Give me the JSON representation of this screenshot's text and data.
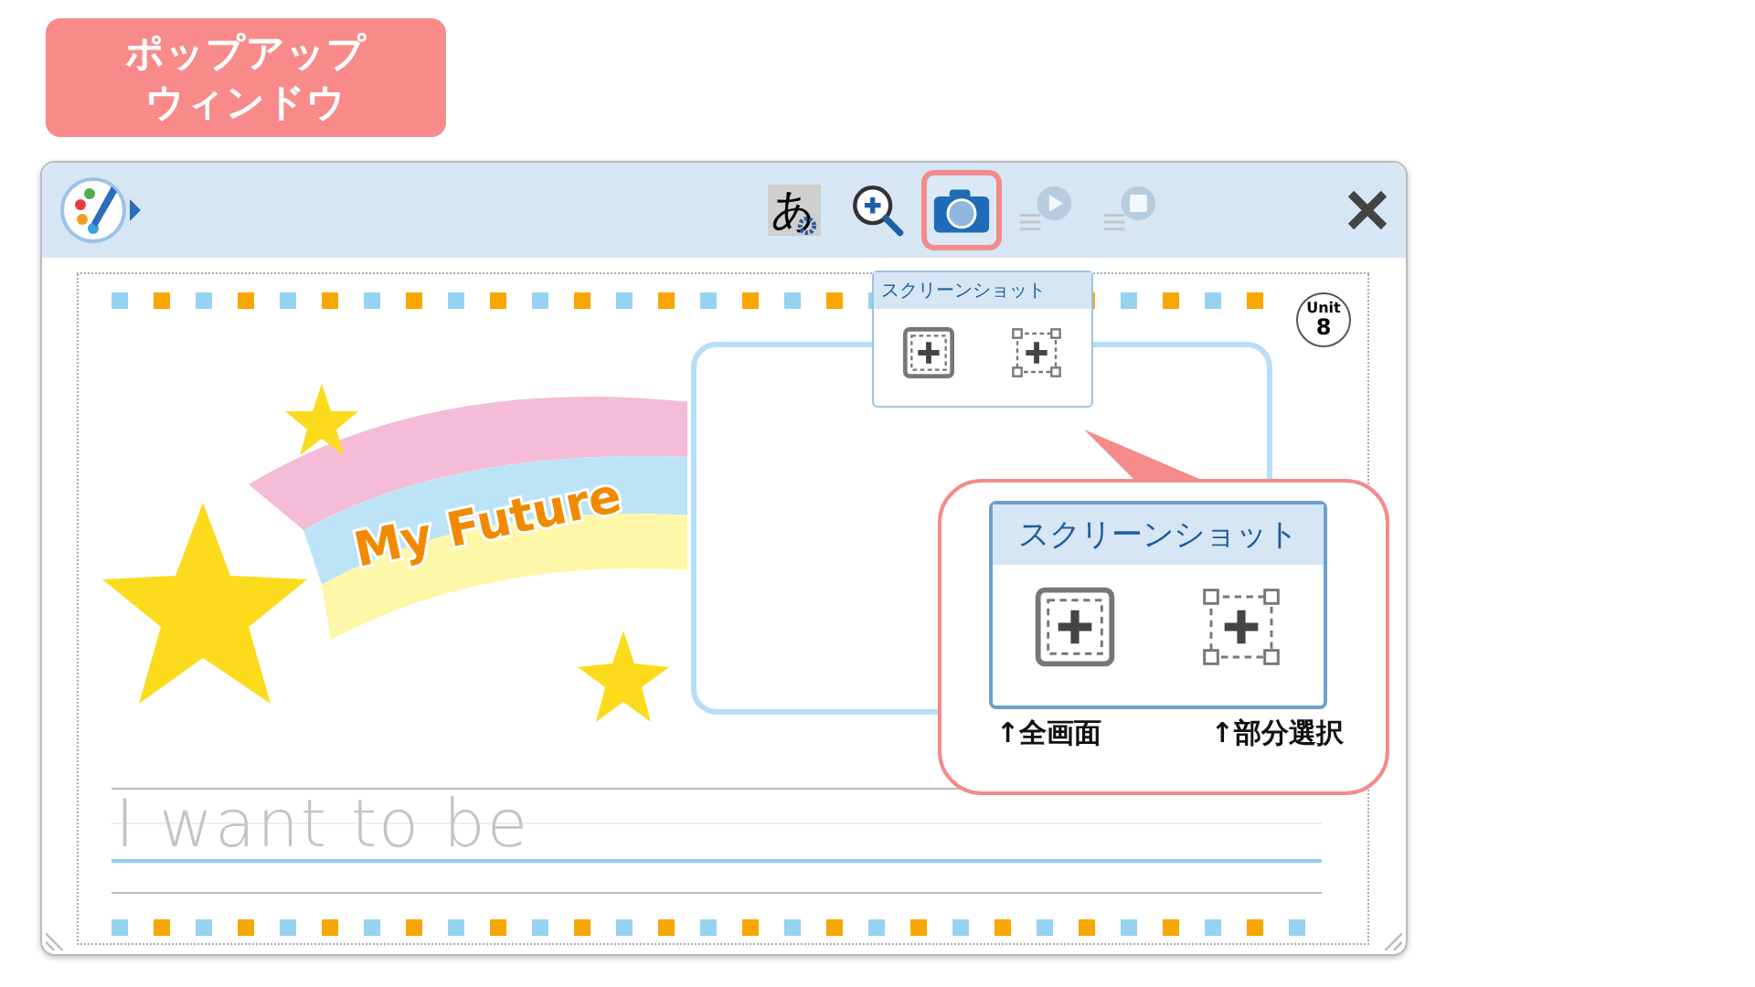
{
  "caption_badge": {
    "lines": [
      "ポップアップ",
      "ウィンドウ"
    ]
  },
  "window": {
    "toolbar": {
      "tools": [
        {
          "kind": "font",
          "glyph": "あ",
          "selected": false,
          "disabled": false
        },
        {
          "kind": "zoom",
          "selected": false,
          "disabled": false
        },
        {
          "kind": "camera",
          "selected": true,
          "disabled": false
        },
        {
          "kind": "play",
          "selected": false,
          "disabled": true
        },
        {
          "kind": "stop",
          "selected": false,
          "disabled": true
        }
      ]
    },
    "tooltip": {
      "title": "スクリーンショット"
    },
    "worksheet": {
      "title": "My Future",
      "unit_label": "Unit",
      "unit_number": "8",
      "trace_text": "I want to be"
    }
  },
  "callout": {
    "title": "スクリーンショット",
    "options": [
      {
        "kind": "full",
        "label": "↑全画面"
      },
      {
        "kind": "partial",
        "label": "↑部分選択"
      }
    ]
  }
}
